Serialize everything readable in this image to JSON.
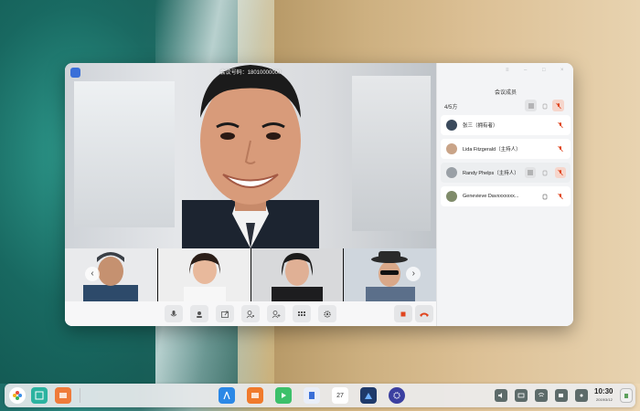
{
  "window": {
    "title": "会议号码：18010000000"
  },
  "panel": {
    "title": "会议成员",
    "count": "4/5方",
    "members": [
      {
        "name": "张三（拥有者）"
      },
      {
        "name": "Lida Fitzgerald（主持人）"
      },
      {
        "name": "Randy Phelps（主持人）"
      },
      {
        "name": "Genevieve Davxxxxxxx..."
      }
    ]
  },
  "toolbar": {
    "items": [
      "mic-icon",
      "camera-user-icon",
      "share-screen-icon",
      "user-settings-icon",
      "user-add-icon",
      "grid-layout-icon",
      "settings-gear-icon",
      "record-stop-icon",
      "hang-up-icon"
    ]
  },
  "taskbar": {
    "time": "10:30",
    "date": "2019/3/12",
    "calendar_day": "27"
  },
  "colors": {
    "accent": "#e0451f",
    "panel_bg": "#f3f4f6"
  }
}
